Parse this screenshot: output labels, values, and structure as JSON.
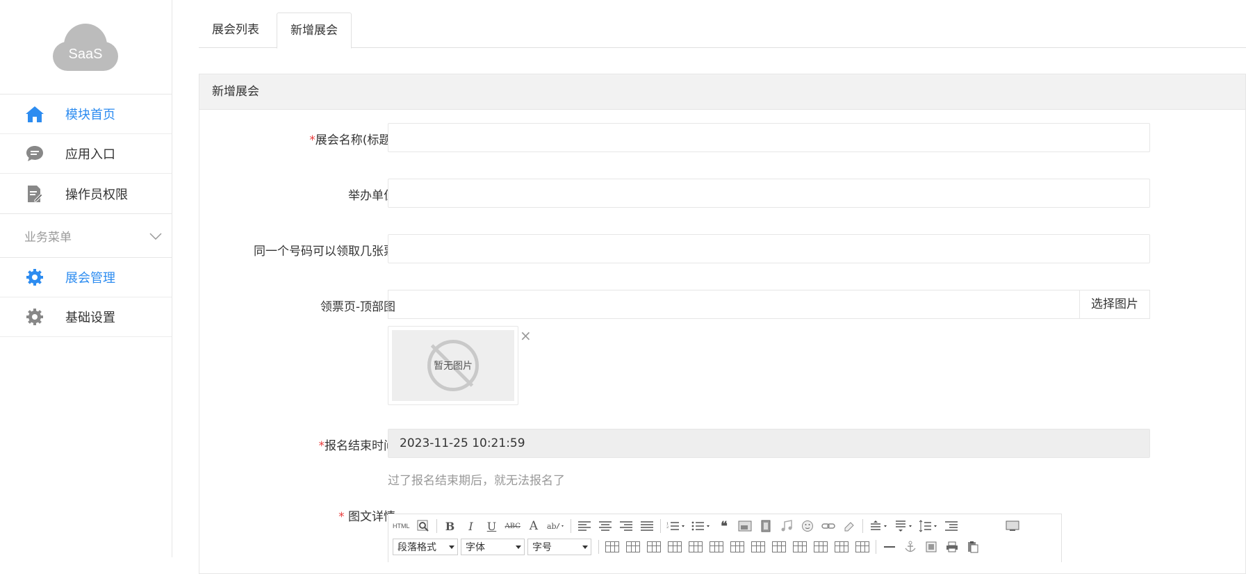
{
  "logo": {
    "text": "SaaS"
  },
  "sidebar": {
    "items": [
      {
        "label": "模块首页",
        "icon": "home-icon",
        "active": true
      },
      {
        "label": "应用入口",
        "icon": "chat-icon",
        "active": false
      },
      {
        "label": "操作员权限",
        "icon": "document-edit-icon",
        "active": false
      }
    ],
    "group": {
      "label": "业务菜单",
      "icon": "chevron-down-icon"
    },
    "sub_items": [
      {
        "label": "展会管理",
        "icon": "gear-icon",
        "active": true
      },
      {
        "label": "基础设置",
        "icon": "gear-icon",
        "active": false
      }
    ]
  },
  "tabs": [
    {
      "label": "展会列表",
      "active": false
    },
    {
      "label": "新增展会",
      "active": true
    }
  ],
  "panel": {
    "title": "新增展会"
  },
  "form": {
    "name": {
      "required_mark": "*",
      "label": "展会名称(标题)",
      "value": ""
    },
    "organizer": {
      "label": "举办单位",
      "value": ""
    },
    "tickets_per_number": {
      "label": "同一个号码可以领取几张票",
      "value": ""
    },
    "top_image": {
      "label": "领票页-顶部图",
      "value": "",
      "button": "选择图片",
      "no_image_text": "暂无图片",
      "remove": "×"
    },
    "end_time": {
      "required_mark": "*",
      "label": "报名结束时间",
      "value": "2023-11-25 10:21:59",
      "hint": "过了报名结束期后，就无法报名了"
    },
    "detail": {
      "required_mark": "* ",
      "label": "图文详情"
    }
  },
  "editor": {
    "selects": {
      "paragraph": "段落格式",
      "font": "字体",
      "size": "字号"
    },
    "buttons": {
      "html": "HTML",
      "bold": "B",
      "italic": "I",
      "underline": "U",
      "strike": "ABC",
      "font_color": "A",
      "quote": "❝"
    }
  }
}
